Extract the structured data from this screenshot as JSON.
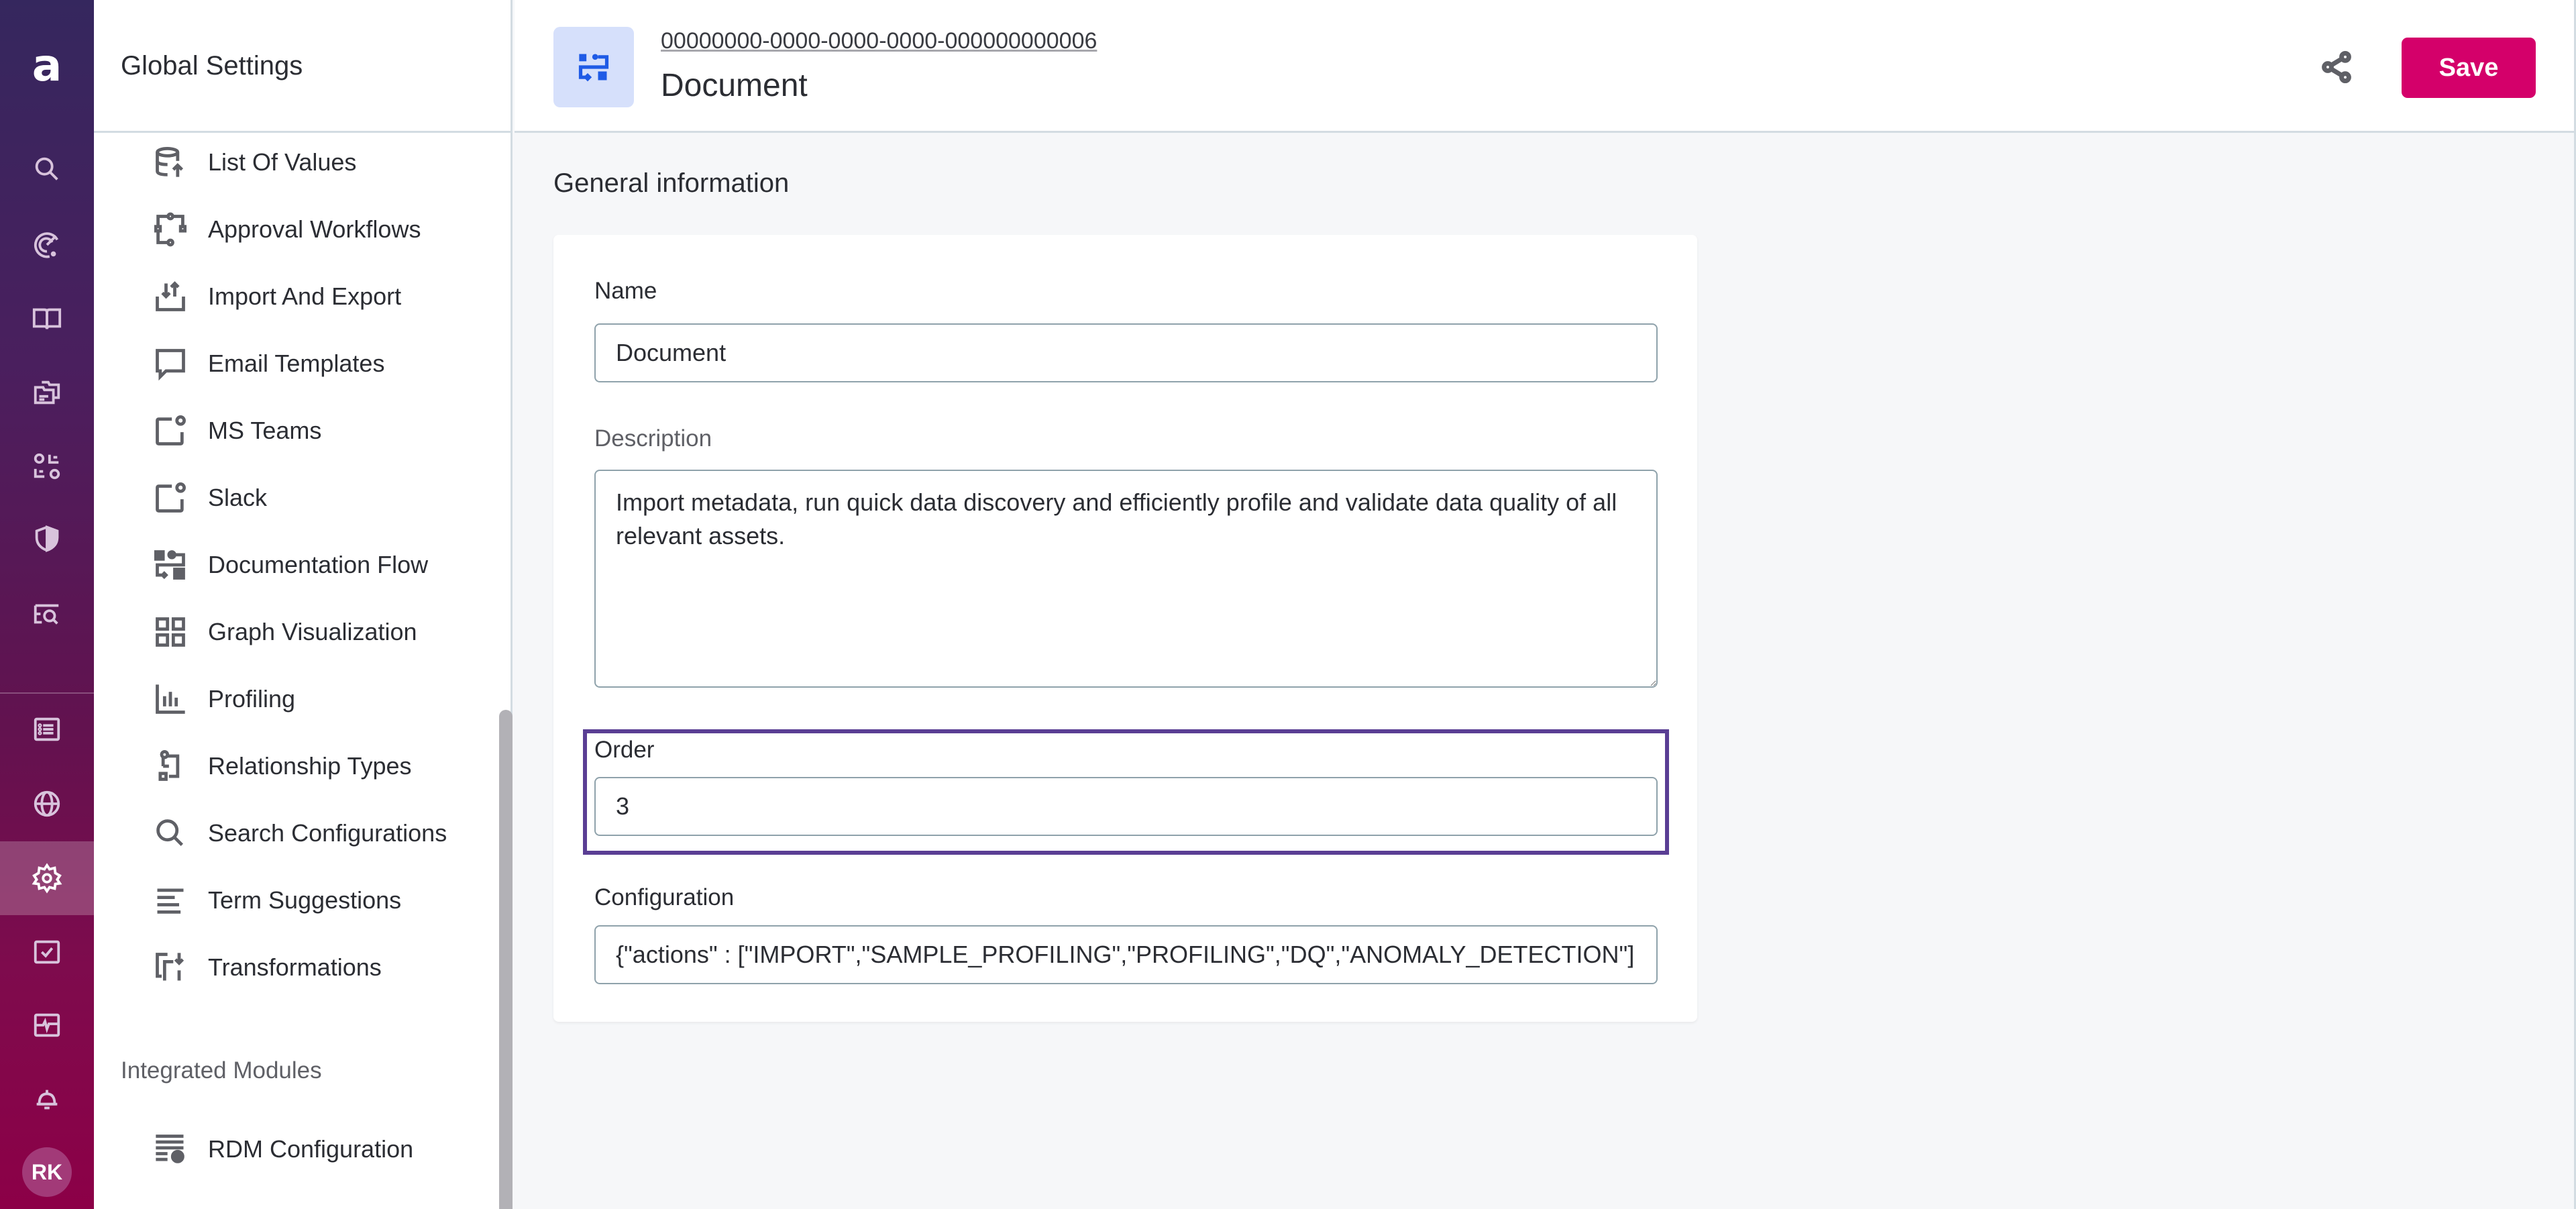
{
  "rail": {
    "logo": "a",
    "items": [
      {
        "name": "search",
        "icon": "search-icon"
      },
      {
        "name": "discovery",
        "icon": "radar-icon"
      },
      {
        "name": "glossary",
        "icon": "book-icon"
      },
      {
        "name": "catalog",
        "icon": "folders-icon"
      },
      {
        "name": "data-quality",
        "icon": "rules-icon"
      },
      {
        "name": "security",
        "icon": "shield-icon"
      },
      {
        "name": "query",
        "icon": "eq-search-icon"
      },
      {
        "name": "reports",
        "icon": "list-icon"
      },
      {
        "name": "global",
        "icon": "globe-icon"
      },
      {
        "name": "settings",
        "icon": "gear-icon",
        "active": true
      },
      {
        "name": "tasks",
        "icon": "checkbox-icon"
      },
      {
        "name": "monitoring",
        "icon": "pulse-icon"
      },
      {
        "name": "notifications",
        "icon": "bell-icon"
      }
    ],
    "avatar": "RK"
  },
  "sidebar": {
    "title": "Global Settings",
    "items": [
      {
        "label": "List Of Values",
        "icon": "database-upload-icon"
      },
      {
        "label": "Approval Workflows",
        "icon": "workflow-icon"
      },
      {
        "label": "Import And Export",
        "icon": "import-export-icon"
      },
      {
        "label": "Email Templates",
        "icon": "comment-icon"
      },
      {
        "label": "MS Teams",
        "icon": "integration-icon"
      },
      {
        "label": "Slack",
        "icon": "integration-icon"
      },
      {
        "label": "Documentation Flow",
        "icon": "flow-icon"
      },
      {
        "label": "Graph Visualization",
        "icon": "grid-icon"
      },
      {
        "label": "Profiling",
        "icon": "bar-chart-icon"
      },
      {
        "label": "Relationship Types",
        "icon": "relationship-icon"
      },
      {
        "label": "Search Configurations",
        "icon": "search-icon"
      },
      {
        "label": "Term Suggestions",
        "icon": "text-lines-icon"
      },
      {
        "label": "Transformations",
        "icon": "transform-icon"
      }
    ],
    "section": "Integrated Modules",
    "section_items": [
      {
        "label": "RDM Configuration",
        "icon": "list-settings-icon"
      }
    ]
  },
  "header": {
    "uuid": "00000000-0000-0000-0000-000000000006",
    "title": "Document",
    "save_label": "Save",
    "colors": {
      "save": "#d4006a",
      "icon_bg": "#d6e0fb",
      "icon_fg": "#1f5be6"
    }
  },
  "form": {
    "section_title": "General information",
    "name_label": "Name",
    "name_value": "Document",
    "description_label": "Description",
    "description_value": "Import metadata, run quick data discovery and efficiently profile and validate data quality of all relevant assets.",
    "order_label": "Order",
    "order_value": "3",
    "configuration_label": "Configuration",
    "configuration_value": "{\"actions\" : [\"IMPORT\",\"SAMPLE_PROFILING\",\"PROFILING\",\"DQ\",\"ANOMALY_DETECTION\"],\"referenceI"
  }
}
